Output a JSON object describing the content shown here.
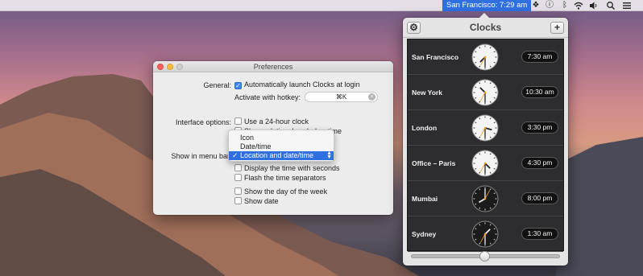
{
  "menubar": {
    "clock_label": "San Francisco: 7:29 am",
    "icons": [
      "dropbox-icon",
      "info-icon",
      "bluetooth-icon",
      "wifi-icon",
      "volume-icon",
      "search-icon",
      "list-icon"
    ]
  },
  "preferences": {
    "title": "Preferences",
    "general_label": "General:",
    "auto_launch_label": "Automatically launch Clocks at login",
    "auto_launch_checked": true,
    "hotkey_label": "Activate with hotkey:",
    "hotkey_value": "⌘K",
    "interface_label": "Interface options:",
    "use_24h_label": "Use a 24-hour clock",
    "relative_days_label": "Show relative days below time",
    "menu_bar_label": "Show in menu bar",
    "seconds_label": "Display the time with seconds",
    "flash_label": "Flash the time separators",
    "day_of_week_label": "Show the day of the week",
    "show_date_label": "Show date"
  },
  "menu_bar_dropdown": {
    "options": [
      "Icon",
      "Date/time",
      "Location and date/time"
    ],
    "selected": "Location and date/time"
  },
  "clocks": {
    "title": "Clocks",
    "rows": [
      {
        "city": "San Francisco",
        "time": "7:30 am",
        "hour": 7,
        "minute": 30,
        "night": false
      },
      {
        "city": "New York",
        "time": "10:30 am",
        "hour": 10,
        "minute": 30,
        "night": false
      },
      {
        "city": "London",
        "time": "3:30 pm",
        "hour": 3,
        "minute": 30,
        "night": false
      },
      {
        "city": "Office – Paris",
        "time": "4:30 pm",
        "hour": 4,
        "minute": 30,
        "night": false
      },
      {
        "city": "Mumbai",
        "time": "8:00 pm",
        "hour": 8,
        "minute": 0,
        "night": true
      },
      {
        "city": "Sydney",
        "time": "1:30 am",
        "hour": 1,
        "minute": 30,
        "night": true
      }
    ],
    "slider_value": 0.5
  }
}
